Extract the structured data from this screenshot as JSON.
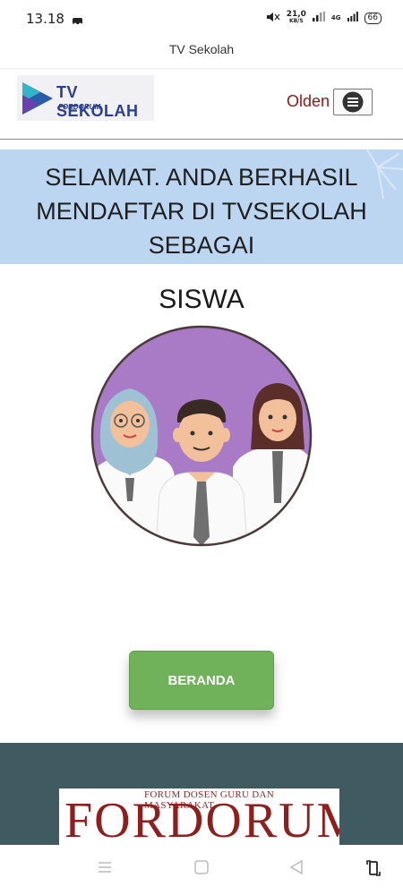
{
  "status_bar": {
    "time": "13.18",
    "speed_value": "21,0",
    "speed_unit": "KB/S",
    "network": "4G",
    "battery": "66"
  },
  "app": {
    "title": "TV Sekolah"
  },
  "header": {
    "logo_text": "TV SEKOLAH",
    "logo_subtext": "FORDORUM",
    "user_name": "Olden"
  },
  "banner": {
    "line1": "SELAMAT. ANDA BERHASIL",
    "line2": "MENDAFTAR DI TVSEKOLAH",
    "line3": "SEBAGAI"
  },
  "role": {
    "title": "SISWA"
  },
  "actions": {
    "home_button": "BERANDA"
  },
  "footer": {
    "logo_subtitle": "FORUM DOSEN GURU DAN MASYARAKAT",
    "logo_word": "FORDORUM"
  },
  "colors": {
    "banner_bg": "#bcd6f1",
    "button_green": "#6fb25a",
    "footer_bg": "#3f5a60",
    "user_name": "#8b1a1a"
  }
}
